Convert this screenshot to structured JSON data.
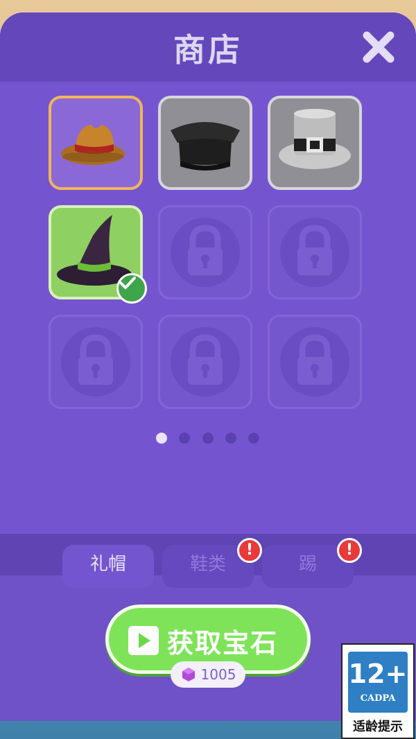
{
  "shop": {
    "title": "商店",
    "close_icon": "close-icon"
  },
  "items": [
    {
      "name": "cowboy-hat",
      "state": "owned"
    },
    {
      "name": "police-cap",
      "state": "owned"
    },
    {
      "name": "top-hat",
      "state": "owned"
    },
    {
      "name": "witch-hat",
      "state": "equipped"
    },
    {
      "name": "locked",
      "state": "locked"
    },
    {
      "name": "locked",
      "state": "locked"
    },
    {
      "name": "locked",
      "state": "locked"
    },
    {
      "name": "locked",
      "state": "locked"
    },
    {
      "name": "locked",
      "state": "locked"
    }
  ],
  "pagination": {
    "pages": 5,
    "current": 1
  },
  "tabs": [
    {
      "label": "礼帽",
      "active": true,
      "alert": false
    },
    {
      "label": "鞋类",
      "active": false,
      "alert": true,
      "alert_text": "!"
    },
    {
      "label": "踢",
      "active": false,
      "alert": true,
      "alert_text": "!"
    }
  ],
  "get_gems": {
    "label": "获取宝石",
    "icon": "play-icon"
  },
  "gems": {
    "count": "1005",
    "icon": "gem-icon"
  },
  "age_rating": {
    "rating": "12+",
    "org": "CADPA",
    "caption": "适龄提示"
  },
  "colors": {
    "panel": "#6b51c6",
    "selected_slot": "#8fd062",
    "button_green": "#7fe35a",
    "alert_red": "#e83a3a",
    "owned_border": "#f2b55c"
  }
}
